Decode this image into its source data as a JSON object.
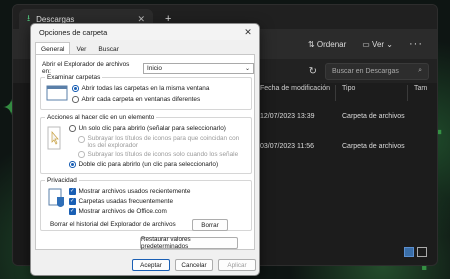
{
  "explorer": {
    "tab_title": "Descargas",
    "new_tab": "+",
    "toolbar": {
      "sort_label": "Ordenar",
      "view_label": "Ver",
      "more": "···"
    },
    "search_placeholder": "Buscar en Descargas",
    "columns": [
      "Fecha de modificación",
      "Tipo",
      "Tam"
    ],
    "rows": [
      {
        "date": "12/07/2023 13:39",
        "type": "Carpeta de archivos"
      },
      {
        "date": "03/07/2023 11:56",
        "type": "Carpeta de archivos"
      }
    ]
  },
  "dialog": {
    "title": "Opciones de carpeta",
    "tabs": [
      "General",
      "Ver",
      "Buscar"
    ],
    "open_label": "Abrir el Explorador de archivos en:",
    "open_value": "Inicio",
    "browse": {
      "legend": "Examinar carpetas",
      "options": [
        "Abrir todas las carpetas en la misma ventana",
        "Abrir cada carpeta en ventanas diferentes"
      ]
    },
    "click": {
      "legend": "Acciones al hacer clic en un elemento",
      "single": "Un solo clic para abrirlo (señalar para seleccionarlo)",
      "sub1": "Subrayar los títulos de iconos para que coincidan con los del explorador",
      "sub2": "Subrayar los títulos de iconos solo cuando los señale",
      "double": "Doble clic para abrirlo (un clic para seleccionarlo)"
    },
    "privacy": {
      "legend": "Privacidad",
      "items": [
        "Mostrar archivos usados recientemente",
        "Carpetas usadas frecuentemente",
        "Mostrar archivos de Office.com"
      ],
      "clear_label": "Borrar el historial del Explorador de archivos",
      "clear_button": "Borrar"
    },
    "restore_button": "Restaurar valores predeterminados",
    "ok": "Aceptar",
    "cancel": "Cancelar",
    "apply": "Aplicar"
  }
}
